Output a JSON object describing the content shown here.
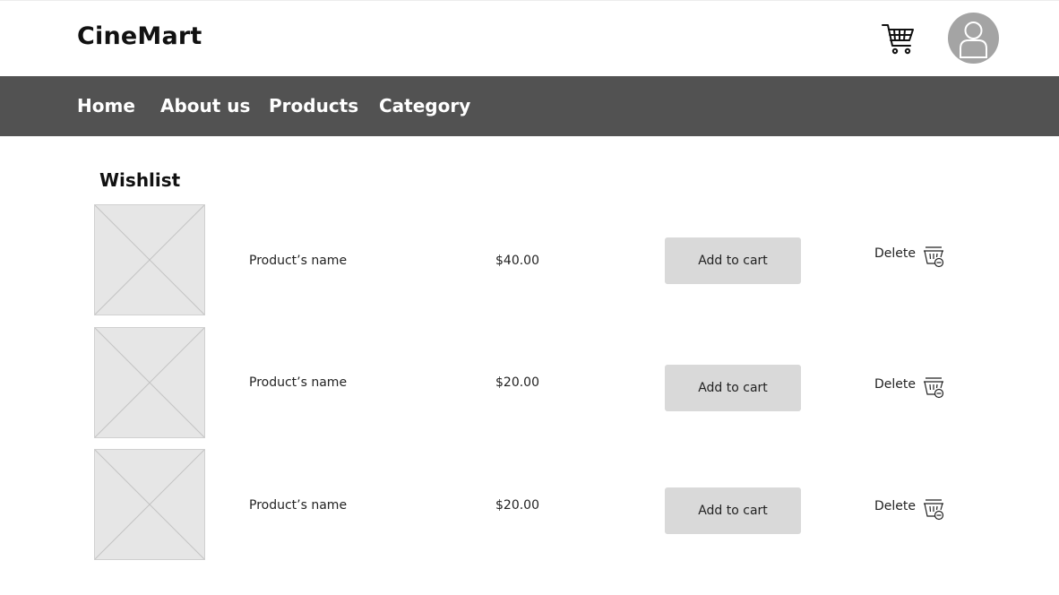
{
  "header": {
    "brand": "CineMart",
    "icons": {
      "cart": "cart-icon",
      "user": "user-avatar-icon"
    }
  },
  "nav": {
    "items": [
      {
        "label": "Home"
      },
      {
        "label": "About us"
      },
      {
        "label": "Products"
      },
      {
        "label": "Category"
      }
    ]
  },
  "wishlist": {
    "title": "Wishlist",
    "items": [
      {
        "name": "Product’s name",
        "price": "$40.00",
        "add_label": "Add to cart",
        "delete_label": "Delete"
      },
      {
        "name": "Product’s name",
        "price": "$20.00",
        "add_label": "Add to cart",
        "delete_label": "Delete"
      },
      {
        "name": "Product’s name",
        "price": "$20.00",
        "add_label": "Add to cart",
        "delete_label": "Delete"
      }
    ]
  },
  "colors": {
    "navbar": "#525252",
    "button": "#d9d9d9",
    "placeholder": "#e6e6e6",
    "avatar": "#a4a4a4"
  }
}
